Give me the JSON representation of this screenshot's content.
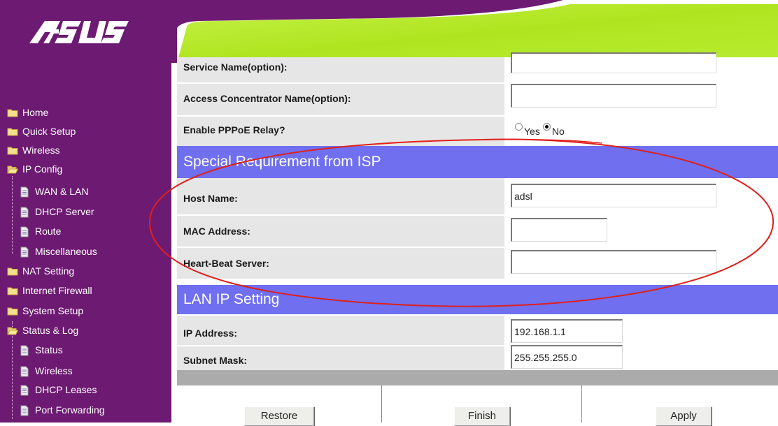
{
  "logo": {
    "text": "ASUS"
  },
  "sidebar": {
    "items": [
      {
        "label": "Home",
        "icon": "folder-closed-icon"
      },
      {
        "label": "Quick Setup",
        "icon": "folder-closed-icon"
      },
      {
        "label": "Wireless",
        "icon": "folder-closed-icon"
      },
      {
        "label": "IP Config",
        "icon": "folder-open-icon"
      },
      {
        "label": "WAN & LAN",
        "icon": "page-icon"
      },
      {
        "label": "DHCP Server",
        "icon": "page-icon"
      },
      {
        "label": "Route",
        "icon": "page-icon"
      },
      {
        "label": "Miscellaneous",
        "icon": "page-icon"
      },
      {
        "label": "NAT Setting",
        "icon": "folder-closed-icon"
      },
      {
        "label": "Internet Firewall",
        "icon": "folder-closed-icon"
      },
      {
        "label": "System Setup",
        "icon": "folder-closed-icon"
      },
      {
        "label": "Status & Log",
        "icon": "folder-open-icon"
      },
      {
        "label": "Status",
        "icon": "page-icon"
      },
      {
        "label": "Wireless",
        "icon": "page-icon"
      },
      {
        "label": "DHCP Leases",
        "icon": "page-icon"
      },
      {
        "label": "Port Forwarding",
        "icon": "page-icon"
      }
    ]
  },
  "form": {
    "service_name_label": "Service Name(option):",
    "service_name_value": "",
    "access_concentrator_label": "Access Concentrator Name(option):",
    "access_concentrator_value": "",
    "pppoe_relay_label": "Enable PPPoE Relay?",
    "pppoe_relay_yes": "Yes",
    "pppoe_relay_no": "No",
    "pppoe_relay_selected": "No",
    "special_section_title": "Special Requirement from ISP",
    "host_name_label": "Host Name:",
    "host_name_value": "adsl",
    "mac_address_label": "MAC Address:",
    "mac_address_value": "",
    "heartbeat_label": "Heart-Beat Server:",
    "heartbeat_value": "",
    "lan_section_title": "LAN IP Setting",
    "ip_address_label": "IP Address:",
    "ip_address_value": "192.168.1.1",
    "subnet_mask_label": "Subnet Mask:",
    "subnet_mask_value": "255.255.255.0"
  },
  "buttons": {
    "restore": "Restore",
    "finish": "Finish",
    "apply": "Apply"
  },
  "colors": {
    "sidebar_bg": "#6d1a72",
    "header_green": "#b3ea22",
    "section_blue": "#6f6fef",
    "row_gray": "#e6e6e6",
    "annotation_red": "#e0201b"
  }
}
